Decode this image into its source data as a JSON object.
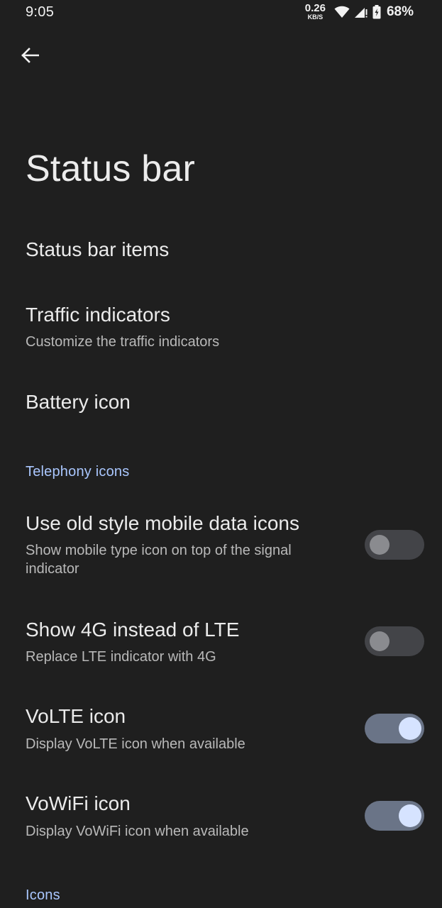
{
  "status_bar": {
    "time": "9:05",
    "net_speed_value": "0.26",
    "net_speed_unit": "KB/S",
    "battery_percent": "68%",
    "icons": [
      "wifi-icon",
      "cell-signal-icon",
      "battery-charging-icon"
    ]
  },
  "header": {
    "back_icon": "arrow-back-icon",
    "title": "Status bar"
  },
  "items": {
    "status_bar_items": {
      "title": "Status bar items"
    },
    "traffic_indicators": {
      "title": "Traffic indicators",
      "summary": "Customize the traffic indicators"
    },
    "battery_icon": {
      "title": "Battery icon"
    }
  },
  "telephony": {
    "header": "Telephony icons",
    "old_style_icons": {
      "title": "Use old style mobile data icons",
      "summary": "Show mobile type icon on top of the signal indicator",
      "enabled": false
    },
    "show_4g": {
      "title": "Show 4G instead of LTE",
      "summary": "Replace LTE indicator with 4G",
      "enabled": false
    },
    "volte": {
      "title": "VoLTE icon",
      "summary": "Display VoLTE icon when available",
      "enabled": true
    },
    "vowifi": {
      "title": "VoWiFi icon",
      "summary": "Display VoWiFi icon when available",
      "enabled": true
    }
  },
  "icons_section": {
    "header": "Icons"
  },
  "colors": {
    "background": "#1f1f1f",
    "accent": "#aac7ff",
    "switch_on_track": "#6a7487",
    "switch_on_thumb": "#d6e3ff",
    "switch_off_track": "#434448",
    "switch_off_thumb": "#8a8b8f"
  }
}
